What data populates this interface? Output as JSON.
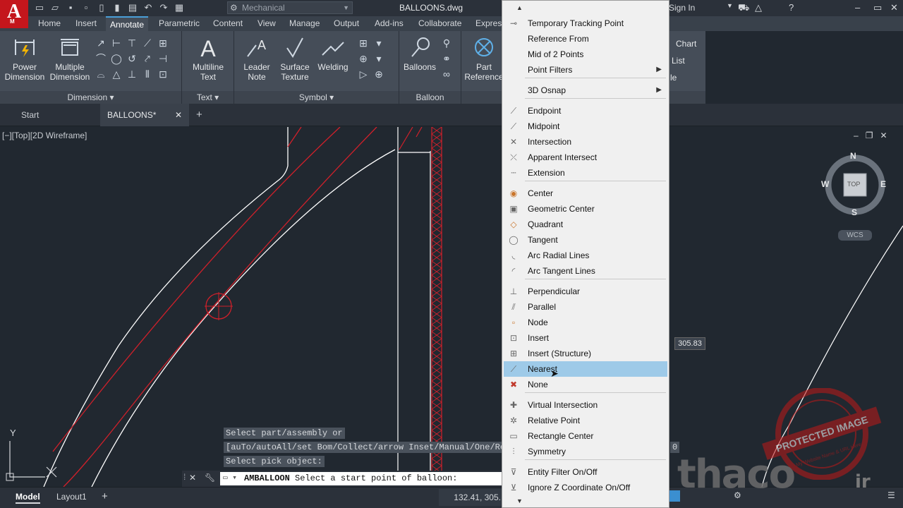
{
  "app": {
    "logo_letter": "A",
    "logo_sub": "M",
    "workspace": "Mechanical",
    "document_title": "BALLOONS.dwg",
    "sign_in": "Sign In",
    "win_min": "–",
    "win_max": "▭",
    "win_close": "✕"
  },
  "ribbon_tabs": [
    "Home",
    "Insert",
    "Annotate",
    "Parametric",
    "Content",
    "View",
    "Manage",
    "Output",
    "Add-ins",
    "Collaborate",
    "Express"
  ],
  "active_tab": "Annotate",
  "ribbon": {
    "power_dimension": "Power Dimension",
    "power_dimension_l1": "Power",
    "power_dimension_l2": "Dimension",
    "multiple_dimension_l1": "Multiple",
    "multiple_dimension_l2": "Dimension",
    "dimension_panel": "Dimension",
    "multiline_text_l1": "Multiline",
    "multiline_text_l2": "Text",
    "text_panel": "Text",
    "leader_note_l1": "Leader",
    "leader_note_l2": "Note",
    "surface_texture_l1": "Surface",
    "surface_texture_l2": "Texture",
    "welding": "Welding",
    "symbol_panel": "Symbol",
    "balloons": "Balloons",
    "balloon_panel": "Balloon",
    "part_reference_l1": "Part",
    "part_reference_l2": "Reference",
    "partial_chart": "Chart",
    "partial_list": "List",
    "partial_le": "le"
  },
  "file_tabs": {
    "start": "Start",
    "active": "BALLOONS*",
    "close": "✕",
    "add": "+"
  },
  "viewport": {
    "label": "[−][Top][2D Wireframe]",
    "compass_n": "N",
    "compass_s": "S",
    "compass_e": "E",
    "compass_w": "W",
    "cube_face": "TOP",
    "wcs": "WCS",
    "dim_value": "305.83",
    "ucs_y": "Y"
  },
  "command": {
    "history_1": "Select part/assembly or",
    "history_2": "[auTo/autoAll/set Bom/Collect/arrow Inset/Manual/One/Ren",
    "history_2_end": "0",
    "history_3": "Select pick object:",
    "name": "AMBALLOON",
    "prompt": "Select a start point of balloon:"
  },
  "status": {
    "model": "Model",
    "layout1": "Layout1",
    "add": "+",
    "coords": "132.41, 305."
  },
  "context_menu": {
    "items": [
      {
        "label": "Temporary Tracking Point",
        "icon": "tracking-icon"
      },
      {
        "label": "Reference From",
        "icon": ""
      },
      {
        "label": "Mid of 2 Points",
        "icon": ""
      },
      {
        "label": "Point Filters",
        "icon": "",
        "submenu": true
      },
      {
        "label": "3D Osnap",
        "icon": "",
        "submenu": true
      },
      {
        "label": "Endpoint",
        "icon": "endpoint-icon"
      },
      {
        "label": "Midpoint",
        "icon": "midpoint-icon"
      },
      {
        "label": "Intersection",
        "icon": "intersection-icon"
      },
      {
        "label": "Apparent Intersect",
        "icon": "apparent-intersect-icon"
      },
      {
        "label": "Extension",
        "icon": "extension-icon"
      },
      {
        "label": "Center",
        "icon": "center-icon"
      },
      {
        "label": "Geometric Center",
        "icon": "geometric-center-icon"
      },
      {
        "label": "Quadrant",
        "icon": "quadrant-icon"
      },
      {
        "label": "Tangent",
        "icon": "tangent-icon"
      },
      {
        "label": "Arc Radial Lines",
        "icon": "arc-radial-icon"
      },
      {
        "label": "Arc Tangent Lines",
        "icon": "arc-tangent-icon"
      },
      {
        "label": "Perpendicular",
        "icon": "perpendicular-icon"
      },
      {
        "label": "Parallel",
        "icon": "parallel-icon"
      },
      {
        "label": "Node",
        "icon": "node-icon"
      },
      {
        "label": "Insert",
        "icon": "insert-icon"
      },
      {
        "label": "Insert (Structure)",
        "icon": "insert-structure-icon"
      },
      {
        "label": "Nearest",
        "icon": "nearest-icon",
        "highlighted": true
      },
      {
        "label": "None",
        "icon": "none-icon"
      },
      {
        "label": "Virtual Intersection",
        "icon": "virtual-intersection-icon"
      },
      {
        "label": "Relative Point",
        "icon": "relative-point-icon"
      },
      {
        "label": "Rectangle Center",
        "icon": "rectangle-center-icon"
      },
      {
        "label": "Symmetry",
        "icon": "symmetry-icon"
      },
      {
        "label": "Entity Filter On/Off",
        "icon": "entity-filter-icon"
      },
      {
        "label": "Ignore Z Coordinate On/Off",
        "icon": "ignore-z-icon"
      }
    ]
  },
  "watermark": {
    "stamp": "PROTECTED IMAGE",
    "stamp_sub": "My Website Name & URL Here",
    "brand": "thaco",
    "brand_suffix": "ir"
  },
  "colors": {
    "accent": "#4a9fd8",
    "highlight": "#9ecae8",
    "logo_red": "#c4161c",
    "canvas": "#212830",
    "drawing_red": "#d0202a"
  }
}
